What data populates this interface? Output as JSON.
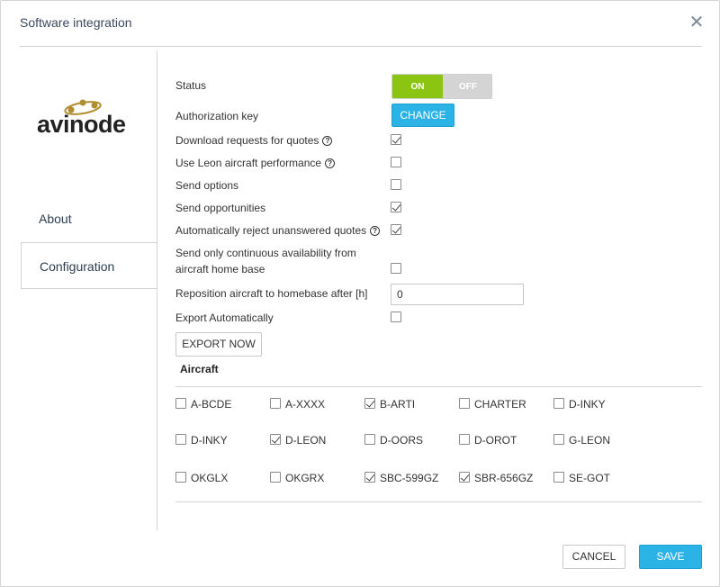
{
  "dialog": {
    "title": "Software integration",
    "close_glyph": "✕"
  },
  "brand": {
    "logo_text": "avinode",
    "logo_icon": "orbit-dots-icon",
    "accent_color": "#b08d2e"
  },
  "tabs": [
    {
      "label": "About",
      "active": false
    },
    {
      "label": "Configuration",
      "active": true
    }
  ],
  "config": {
    "status_label": "Status",
    "status_on": "ON",
    "status_off": "OFF",
    "status_value": "ON",
    "auth_label": "Authorization key",
    "auth_button": "CHANGE",
    "download_label": "Download requests for quotes",
    "download_checked": true,
    "performance_label": "Use Leon aircraft performance",
    "performance_checked": false,
    "send_options_label": "Send options",
    "send_options_checked": false,
    "send_opportunities_label": "Send opportunities",
    "send_opportunities_checked": true,
    "auto_reject_label": "Automatically reject unanswered quotes",
    "auto_reject_checked": true,
    "continuous_label_1": "Send only continuous availability from",
    "continuous_label_2": "aircraft home base",
    "continuous_checked": false,
    "reposition_label": "Reposition aircraft to homebase after [h]",
    "reposition_value": "0",
    "export_auto_label": "Export Automatically",
    "export_auto_checked": false,
    "export_button": "EXPORT NOW",
    "help_glyph": "?"
  },
  "aircraft": {
    "title": "Aircraft",
    "items": [
      {
        "label": "A-BCDE",
        "checked": false
      },
      {
        "label": "A-XXXX",
        "checked": false
      },
      {
        "label": "B-ARTI",
        "checked": true
      },
      {
        "label": "CHARTER",
        "checked": false
      },
      {
        "label": "D-INKY",
        "checked": false
      },
      {
        "label": "D-INKY",
        "checked": false
      },
      {
        "label": "D-LEON",
        "checked": true
      },
      {
        "label": "D-OORS",
        "checked": false
      },
      {
        "label": "D-OROT",
        "checked": false
      },
      {
        "label": "G-LEON",
        "checked": false
      },
      {
        "label": "OKGLX",
        "checked": false
      },
      {
        "label": "OKGRX",
        "checked": false
      },
      {
        "label": "SBC-599GZ",
        "checked": true
      },
      {
        "label": "SBR-656GZ",
        "checked": true
      },
      {
        "label": "SE-GOT",
        "checked": false
      }
    ]
  },
  "footer": {
    "cancel": "CANCEL",
    "save": "SAVE"
  },
  "colors": {
    "toggle_on": "#8cc511",
    "toggle_off": "#d4d4d4",
    "primary": "#2cb3e6"
  }
}
